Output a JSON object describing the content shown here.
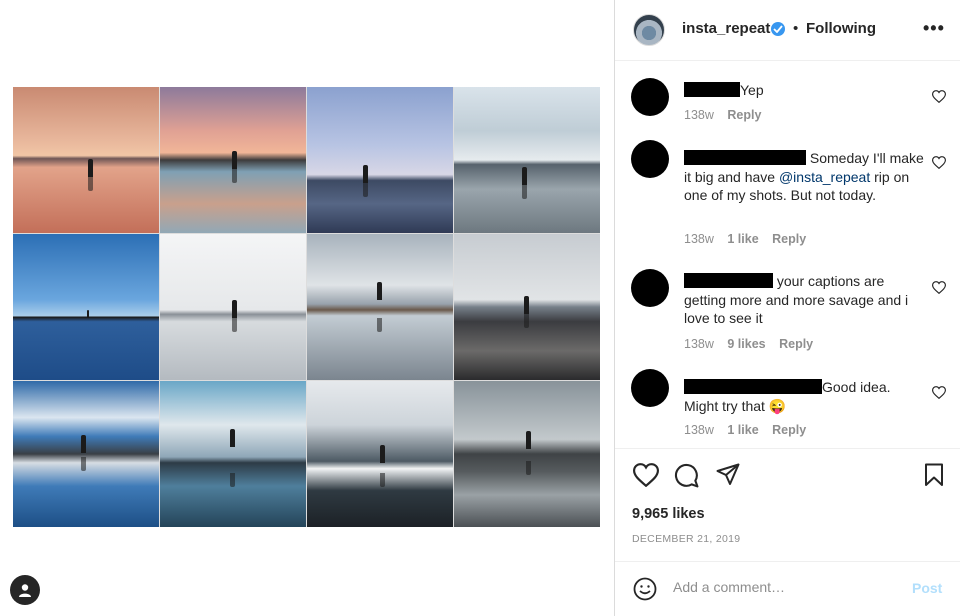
{
  "post": {
    "username": "insta_repeat",
    "separator": "•",
    "follow_state": "Following",
    "more": "•••"
  },
  "grid": {
    "tiles": [
      {
        "scene": "sunset-pink-lake"
      },
      {
        "scene": "sunset-reflection-clouds"
      },
      {
        "scene": "blue-sky-shore-walker"
      },
      {
        "scene": "cloudy-beach-walker"
      },
      {
        "scene": "deep-blue-horizon"
      },
      {
        "scene": "white-mist-lake"
      },
      {
        "scene": "snowy-mountain-reflection"
      },
      {
        "scene": "grey-rocky-shore"
      },
      {
        "scene": "blue-mountain-clouds"
      },
      {
        "scene": "lake-snow-peaks"
      },
      {
        "scene": "snow-valley-reflection"
      },
      {
        "scene": "dark-mountain-lake"
      }
    ]
  },
  "comments": [
    {
      "text_after": "Yep",
      "time": "138w",
      "likes": "",
      "reply": "Reply"
    },
    {
      "text_after": "Someday I'll make it big and have",
      "mention": "@insta_repeat",
      "text_tail": "rip on one of my shots. But not today.",
      "time": "138w",
      "likes": "1 like",
      "reply": "Reply"
    },
    {
      "text_after": "your captions are getting more and more savage and i love to see it",
      "time": "138w",
      "likes": "9 likes",
      "reply": "Reply"
    },
    {
      "text_after": "Good idea. Might try that",
      "emoji": "😜",
      "time": "138w",
      "likes": "1 like",
      "reply": "Reply"
    }
  ],
  "engagement": {
    "likes": "9,965 likes",
    "date": "DECEMBER 21, 2019"
  },
  "composer": {
    "placeholder": "Add a comment…",
    "post_label": "Post"
  },
  "colors": {
    "verified": "#3897f0",
    "mention": "#00376b",
    "post_disabled": "#b2dffc"
  },
  "icons": [
    "heart-icon",
    "comment-icon",
    "share-icon",
    "bookmark-icon",
    "smile-icon",
    "verified-icon",
    "more-icon",
    "user-icon"
  ]
}
